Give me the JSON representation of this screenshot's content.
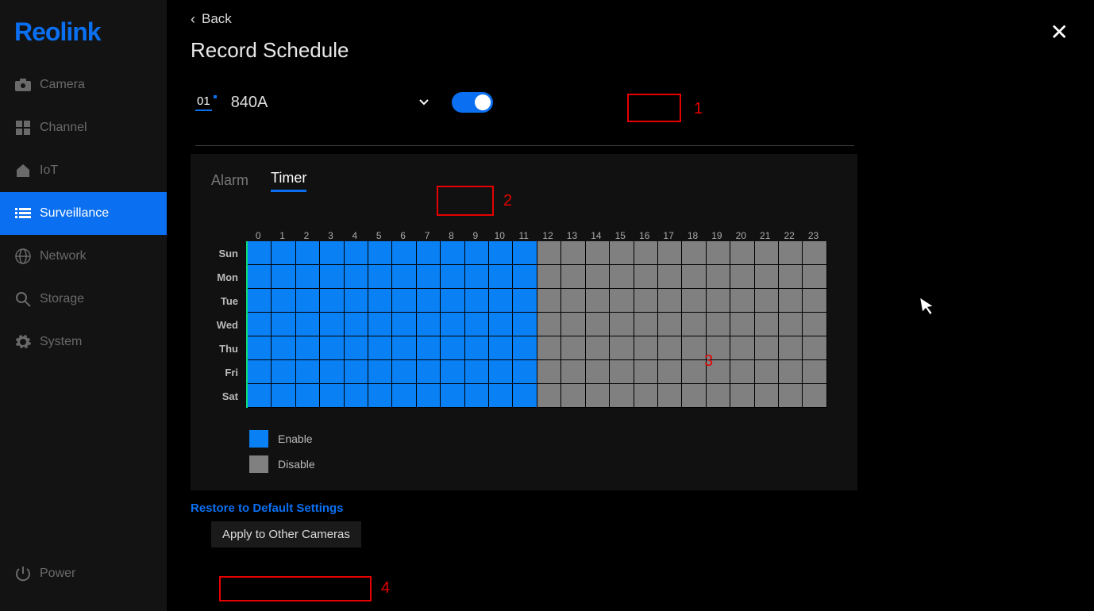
{
  "logo": "Reolink",
  "sidebar": {
    "items": [
      {
        "label": "Camera",
        "icon": "camera-icon"
      },
      {
        "label": "Channel",
        "icon": "grid-icon"
      },
      {
        "label": "IoT",
        "icon": "home-icon"
      },
      {
        "label": "Surveillance",
        "icon": "list-icon",
        "active": true
      },
      {
        "label": "Network",
        "icon": "globe-icon"
      },
      {
        "label": "Storage",
        "icon": "search-icon"
      },
      {
        "label": "System",
        "icon": "gear-icon"
      }
    ],
    "power": "Power"
  },
  "header": {
    "back": "Back",
    "title": "Record Schedule"
  },
  "camera": {
    "number": "01",
    "name": "840A",
    "enabled": true
  },
  "tabs": [
    {
      "label": "Alarm",
      "active": false
    },
    {
      "label": "Timer",
      "active": true
    }
  ],
  "schedule": {
    "hours": [
      "0",
      "1",
      "2",
      "3",
      "4",
      "5",
      "6",
      "7",
      "8",
      "9",
      "10",
      "11",
      "12",
      "13",
      "14",
      "15",
      "16",
      "17",
      "18",
      "19",
      "20",
      "21",
      "22",
      "23"
    ],
    "days": [
      "Sun",
      "Mon",
      "Tue",
      "Wed",
      "Thu",
      "Fri",
      "Sat"
    ],
    "active_hours_start": 0,
    "active_hours_end": 11
  },
  "legend": {
    "enable": "Enable",
    "disable": "Disable"
  },
  "actions": {
    "restore": "Restore to Default Settings",
    "apply": "Apply to Other Cameras"
  },
  "annotations": {
    "n1": "1",
    "n2": "2",
    "n3": "3",
    "n4": "4"
  }
}
